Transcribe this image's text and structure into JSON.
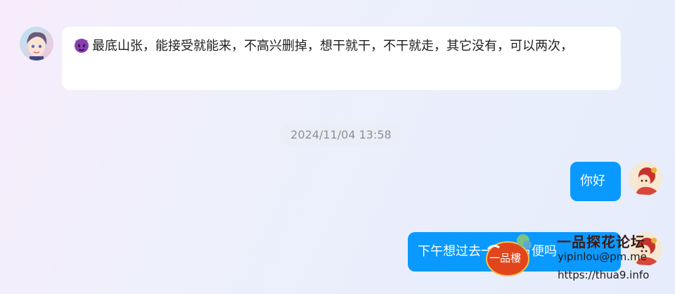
{
  "messages": {
    "incoming": {
      "emoji": "devil-emoji",
      "text": "最底山张，能接受就能来，不高兴删掉，想干就干，不干就走，其它没有，可以两次，"
    },
    "timestamp": "2024/11/04 13:58",
    "outgoing": [
      {
        "text": "你好"
      },
      {
        "text": "下午想过去一下，方便吗"
      }
    ]
  },
  "watermark": {
    "logo_text": "一品樓",
    "title": "一品探花论坛",
    "email": "yipinlou@pm.me",
    "url": "https://thua9.info"
  },
  "colors": {
    "outgoing_bubble": "#0a99ff",
    "incoming_bubble": "#ffffff",
    "accent": "#0a99ff"
  }
}
